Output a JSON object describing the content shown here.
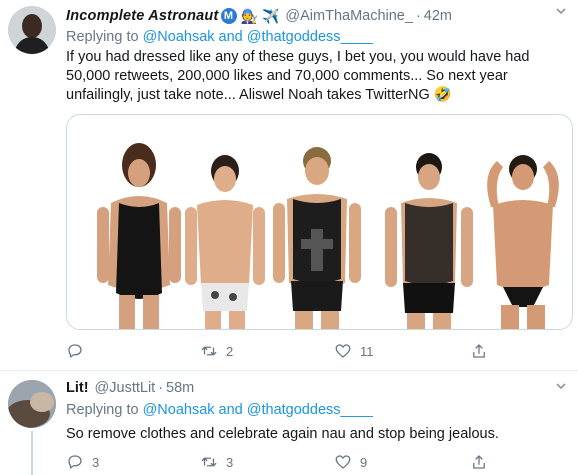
{
  "tweets": [
    {
      "display_name": "Incomplete Astronaut",
      "emojis": [
        "🧑‍🔧",
        "✈️"
      ],
      "handle": "@AimThaMachine_",
      "separator": "·",
      "time": "42m",
      "reply_prefix": "Replying to",
      "reply_targets": "@Noahsak and @thatgoddess____",
      "text_lines": [
        "If you had dressed like any of these guys, I bet you, you would have had",
        "50,000 retweets, 200,000 likes and 70,000 comments... So next year",
        "unfailingly, just take note... Aliswel Noah takes TwitterNG 🤣"
      ],
      "reply_count": "",
      "retweet_count": "2",
      "like_count": "11"
    },
    {
      "display_name": "Lit!",
      "handle": "@JusttLit",
      "separator": "·",
      "time": "58m",
      "reply_prefix": "Replying to",
      "reply_targets": "@Noahsak and @thatgoddess____",
      "text_lines": [
        "So remove clothes and celebrate again nau and stop being jealous."
      ],
      "reply_count": "3",
      "retweet_count": "3",
      "like_count": "9"
    }
  ],
  "icons": {
    "verified": "M",
    "reply": "reply-icon",
    "retweet": "retweet-icon",
    "like": "heart-icon",
    "share": "share-icon"
  },
  "colors": {
    "link": "#1b95e0",
    "muted": "#657786",
    "verified": "#2b7bd6"
  }
}
